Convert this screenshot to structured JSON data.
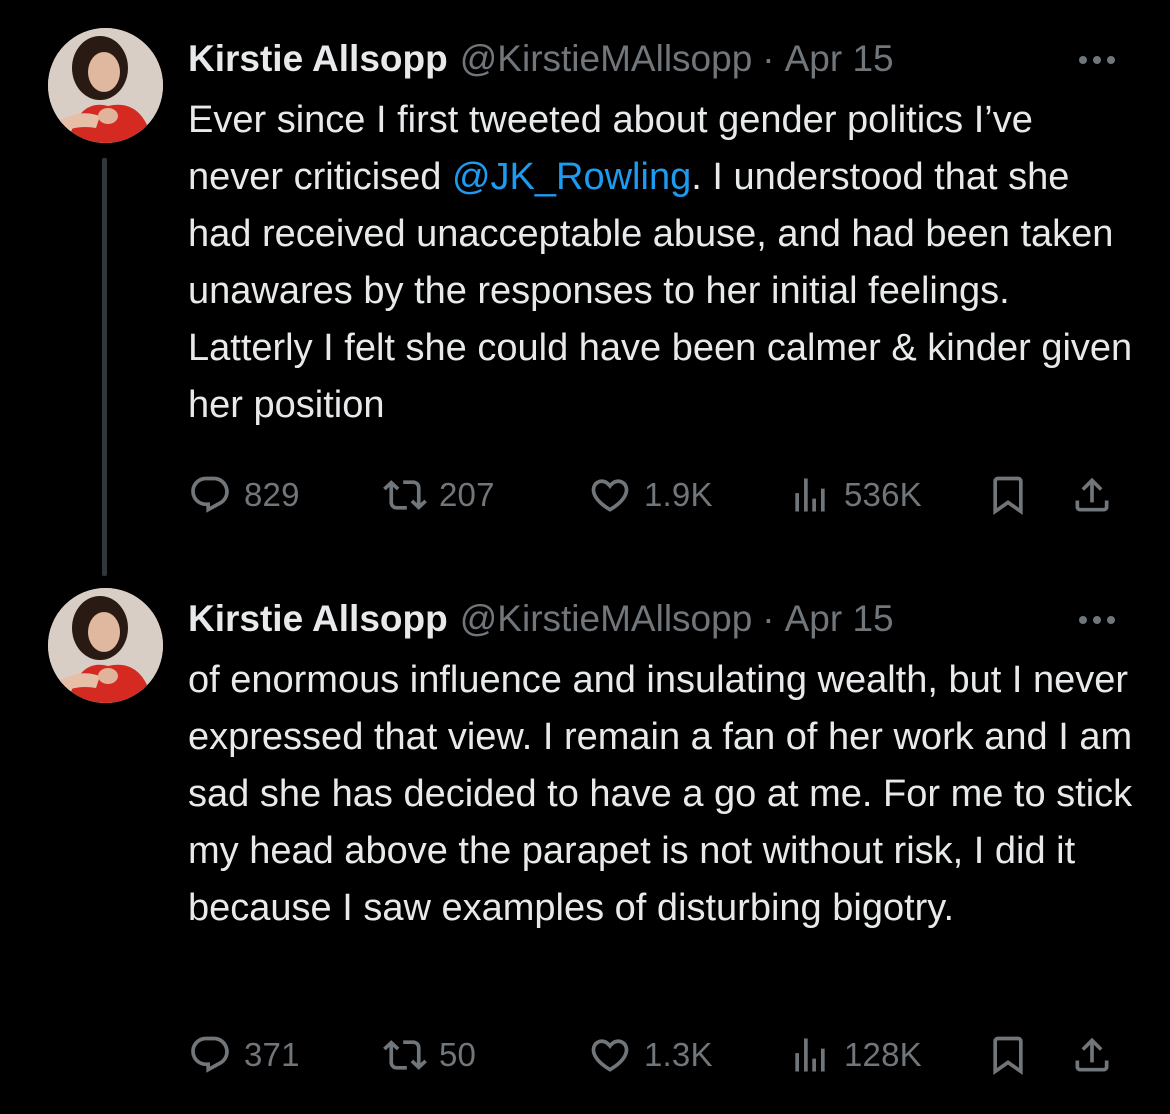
{
  "tweets": [
    {
      "author_name": "Kirstie Allsopp",
      "handle": "@KirstieMAllsopp",
      "separator": "·",
      "date": "Apr 15",
      "text_before": "Ever since I first tweeted about gender politics I’ve never criticised ",
      "mention": "@JK_Rowling",
      "text_after": ". I understood that she had received unacceptable abuse, and had been taken unawares by the responses to her initial feelings. Latterly I felt she could have been calmer & kinder given her position",
      "replies": "829",
      "reposts": "207",
      "likes": "1.9K",
      "views": "536K"
    },
    {
      "author_name": "Kirstie Allsopp",
      "handle": "@KirstieMAllsopp",
      "separator": "·",
      "date": "Apr 15",
      "text": "of enormous influence and insulating wealth, but I never expressed that view. I remain a fan of her work and I am sad she has decided to have a go at me. For me to stick my head above the parapet is not without risk, I did it because I saw examples of disturbing bigotry.",
      "replies": "371",
      "reposts": "50",
      "likes": "1.3K",
      "views": "128K"
    }
  ],
  "icons": {
    "reply": "reply-icon",
    "repost": "repost-icon",
    "like": "heart-icon",
    "views": "views-icon",
    "bookmark": "bookmark-icon",
    "share": "share-icon",
    "more": "more-icon"
  },
  "colors": {
    "background": "#000000",
    "text": "#e7e9ea",
    "secondary": "#71767b",
    "link": "#1d9bf0",
    "thread_line": "#333639"
  }
}
